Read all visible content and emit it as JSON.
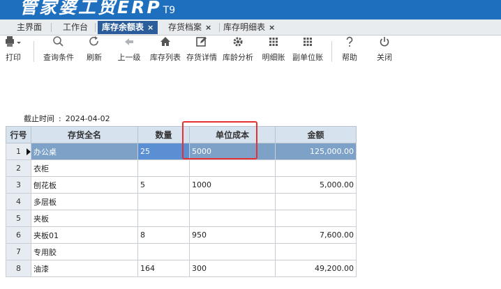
{
  "app": {
    "brand": "管家婆工贸ERP",
    "version": "T9"
  },
  "tabs": [
    {
      "label": "主界面",
      "active": false,
      "closable": false
    },
    {
      "label": "工作台",
      "active": false,
      "closable": false
    },
    {
      "label": "库存余额表",
      "active": true,
      "closable": true
    },
    {
      "label": "存货档案",
      "active": false,
      "closable": true
    },
    {
      "label": "库存明细表",
      "active": false,
      "closable": true
    }
  ],
  "tab_close_glyph": "×",
  "toolbar": {
    "print": "打印",
    "query": "查询条件",
    "refresh": "刷新",
    "up": "上一级",
    "stock_list": "库存列表",
    "stock_detail": "存货详情",
    "aging": "库龄分析",
    "ledger": "明细账",
    "sub_ledger": "副单位账",
    "help": "帮助",
    "close": "关闭"
  },
  "cutoff": {
    "label": "截止时间",
    "colon": ":",
    "date": "2024-04-02"
  },
  "table": {
    "headers": {
      "row_no": "行号",
      "name": "存货全名",
      "qty": "数量",
      "unit_cost": "单位成本",
      "amount": "金额"
    },
    "rows": [
      {
        "no": "1",
        "name": "办公桌",
        "qty": "25",
        "unit_cost": "5000",
        "amount": "125,000.00"
      },
      {
        "no": "2",
        "name": "衣柜",
        "qty": "",
        "unit_cost": "",
        "amount": ""
      },
      {
        "no": "3",
        "name": "刨花板",
        "qty": "5",
        "unit_cost": "1000",
        "amount": "5,000.00"
      },
      {
        "no": "4",
        "name": "多层板",
        "qty": "",
        "unit_cost": "",
        "amount": ""
      },
      {
        "no": "5",
        "name": "夹板",
        "qty": "",
        "unit_cost": "",
        "amount": ""
      },
      {
        "no": "6",
        "name": "夹板01",
        "qty": "8",
        "unit_cost": "950",
        "amount": "7,600.00"
      },
      {
        "no": "7",
        "name": "专用胶",
        "qty": "",
        "unit_cost": "",
        "amount": ""
      },
      {
        "no": "8",
        "name": "油漆",
        "qty": "164",
        "unit_cost": "300",
        "amount": "49,200.00"
      }
    ]
  },
  "colors": {
    "brand_bar": "#1f6fbf",
    "active_tab": "#2b5d9a",
    "selected_row": "#7ea1c8",
    "highlight_box": "#e53030"
  }
}
